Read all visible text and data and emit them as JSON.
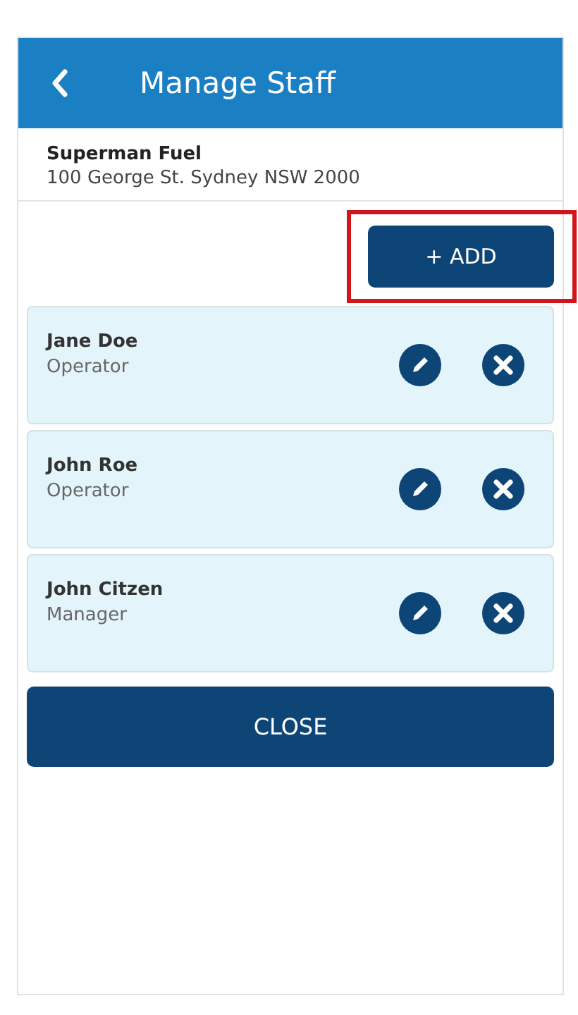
{
  "header": {
    "title": "Manage Staff"
  },
  "business": {
    "name": "Superman Fuel",
    "address": "100 George St. Sydney NSW 2000"
  },
  "add_button": {
    "label": "+ ADD",
    "highlighted": true
  },
  "staff": [
    {
      "name": "Jane Doe",
      "role": "Operator"
    },
    {
      "name": "John Roe",
      "role": "Operator"
    },
    {
      "name": "John Citzen",
      "role": "Manager"
    }
  ],
  "close_button": {
    "label": "CLOSE"
  }
}
